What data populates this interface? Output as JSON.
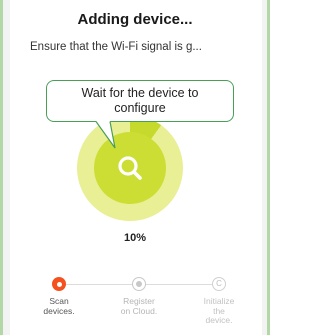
{
  "header": {
    "title": "Adding device...",
    "subtitle": "Ensure that the Wi-Fi signal is g..."
  },
  "callout": {
    "line1": "Wait for the device to",
    "line2": "configure"
  },
  "progress": {
    "percent_label": "10%",
    "value": 0.1,
    "icon": "search-icon",
    "colors": {
      "ring_track": "#e8ef94",
      "ring_fill": "#c6d92d",
      "center": "#ccde34",
      "callout_border": "#4a9f56",
      "frame": "#b4d7a8"
    }
  },
  "steps": [
    {
      "label_line1": "Scan",
      "label_line2": "devices.",
      "label_line3": "",
      "state": "active",
      "color": "#f4511e"
    },
    {
      "label_line1": "Register",
      "label_line2": "on Cloud.",
      "label_line3": "",
      "state": "pending"
    },
    {
      "label_line1": "Initialize",
      "label_line2": "the",
      "label_line3": "device.",
      "state": "pending",
      "icon_char": "C"
    }
  ]
}
